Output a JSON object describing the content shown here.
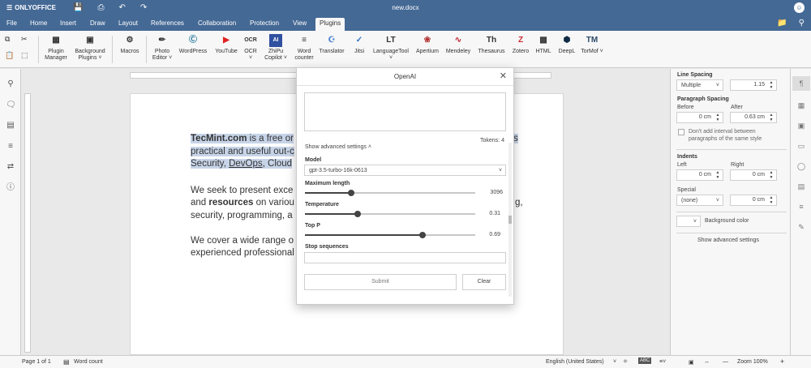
{
  "app": {
    "brand": "ONLYOFFICE",
    "doc_title": "new.docx",
    "avatar": "☺"
  },
  "tabs": [
    "File",
    "Home",
    "Insert",
    "Draw",
    "Layout",
    "References",
    "Collaboration",
    "Protection",
    "View",
    "Plugins"
  ],
  "active_tab": "Plugins",
  "toolbar": {
    "plugin_manager": "Plugin Manager",
    "background_plugins": "Background Plugins",
    "macros": "Macros",
    "photo_editor": "Photo Editor",
    "wordpress": "WordPress",
    "youtube": "YouTube",
    "ocr": "OCR",
    "zhipu": "ZhiPu Copilot",
    "word_counter": "Word counter",
    "translator": "Translator",
    "jitsi": "Jitsi",
    "languagetool": "LanguageTool",
    "apertium": "Apertium",
    "mendeley": "Mendeley",
    "thesaurus": "Thesaurus",
    "zotero": "Zotero",
    "html": "HTML",
    "deepl": "DeepL",
    "tormof": "TorMof"
  },
  "document": {
    "p1_bold": "TecMint.com",
    "p1_line1_rest": " is a free or",
    "p1_line2": "practical and useful out-c",
    "p1_line3_a": "Security, ",
    "p1_line3_link": "DevOps",
    "p1_line3_b": ", Cloud",
    "p1_tail1": "s",
    "p2_line1": "We seek to present exce",
    "p2_line2_a": "and ",
    "p2_line2_bold": "resources",
    "p2_line2_b": " on variou",
    "p2_line2_tail": "g,",
    "p2_line3": "security, programming, a",
    "p3_line1": "We cover a wide range o",
    "p3_line2": "experienced professional"
  },
  "dialog": {
    "title": "OpenAI",
    "tokens": "Tokens: 4",
    "advanced_toggle": "Show advanced settings ˄",
    "model_label": "Model",
    "model_value": "gpt-3.5-turbo-16k-0613",
    "max_length_label": "Maximum length",
    "max_length_value": "3096",
    "max_length_fraction": 0.27,
    "temperature_label": "Temperature",
    "temperature_value": "0.31",
    "temperature_fraction": 0.31,
    "top_p_label": "Top P",
    "top_p_value": "0.69",
    "top_p_fraction": 0.69,
    "stop_label": "Stop sequences",
    "submit": "Submit",
    "clear": "Clear"
  },
  "right_panel": {
    "line_spacing": "Line Spacing",
    "line_mode": "Multiple",
    "line_value": "1.15",
    "paragraph_spacing": "Paragraph Spacing",
    "before": "Before",
    "after": "After",
    "before_value": "0 cm",
    "after_value": "0.63 cm",
    "dont_add": "Don't add interval between paragraphs of the same style",
    "indents": "Indents",
    "left": "Left",
    "right": "Right",
    "left_value": "0 cm",
    "right_value": "0 cm",
    "special": "Special",
    "special_mode": "(none)",
    "special_value": "0 cm",
    "background_color": "Background color",
    "show_advanced": "Show advanced settings"
  },
  "status": {
    "page": "Page 1 of 1",
    "word_count": "Word count",
    "language": "English (United States)",
    "zoom": "Zoom 100%"
  }
}
